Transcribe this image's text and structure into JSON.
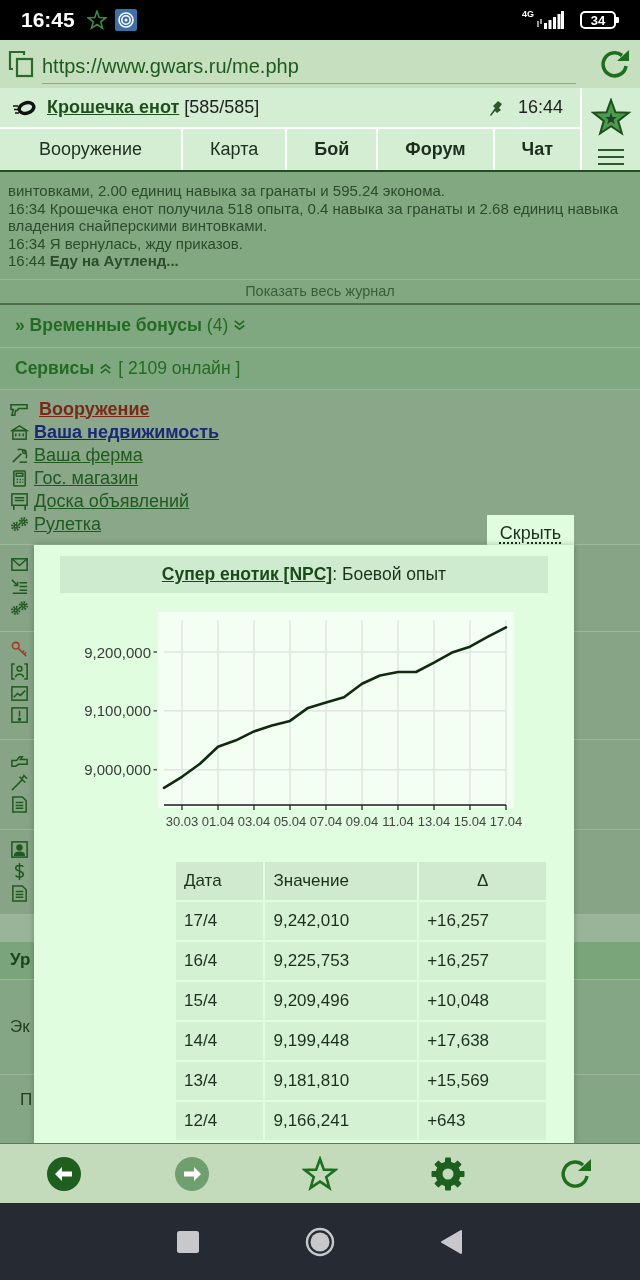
{
  "status_bar": {
    "time": "16:45",
    "network": "4G",
    "battery": "34"
  },
  "browser": {
    "url": "https://www.gwars.ru/me.php"
  },
  "header": {
    "player_name": "Крошечка енот",
    "hp": "[585/585]",
    "time": "16:44"
  },
  "nav_tabs": [
    {
      "label": "Вооружение",
      "emphasized": false
    },
    {
      "label": "Карта",
      "emphasized": false
    },
    {
      "label": "Бой",
      "emphasized": true
    },
    {
      "label": "Форум",
      "emphasized": true
    },
    {
      "label": "Чат",
      "emphasized": true
    }
  ],
  "log": {
    "entries": [
      "винтовками, 2.00 единиц навыка за гранаты и 595.24 эконома.",
      "16:34 Крошечка енот получила 518 опыта, 0.4 навыка за гранаты и 2.68 единиц навыка владения снайперскими винтовками.",
      "16:34 Я вернулась, жду приказов.",
      "16:44 **Еду на Аутленд...**"
    ],
    "show_all": "Показать весь журнал"
  },
  "bonuses": {
    "label": "» Временные бонусы",
    "count": "(4)",
    "expanded": false
  },
  "services": {
    "label": "Сервисы",
    "online": "[ 2109 онлайн ]",
    "expanded": true,
    "items": [
      {
        "label": "Вооружение",
        "kind": "current"
      },
      {
        "label": "Ваша недвижимость",
        "kind": "notice"
      },
      {
        "label": "Ваша ферма",
        "kind": "link"
      },
      {
        "label": "Гос. магазин",
        "kind": "link"
      },
      {
        "label": "Доска объявлений",
        "kind": "link"
      },
      {
        "label": "Рулетка",
        "kind": "link"
      }
    ]
  },
  "section": {
    "heading": "Ур",
    "rows": [
      "Эк",
      "П"
    ]
  },
  "popup": {
    "hide_button": "Скрыть",
    "title_link": "Супер енотик [NPC]",
    "title_text": ": Боевой опыт",
    "chart_data": {
      "type": "line",
      "grid": true,
      "categories": [
        null,
        "30.03",
        null,
        "01.04",
        null,
        "03.04",
        null,
        "05.04",
        null,
        "07.04",
        null,
        "09.04",
        null,
        "11.04",
        null,
        "13.04",
        null,
        "15.04",
        null,
        "17.04"
      ],
      "series": [
        {
          "color": "#0f2a0f",
          "values": [
            8969000,
            8988000,
            9010000,
            9039000,
            9050000,
            9065000,
            9075000,
            9083000,
            9105000,
            9114000,
            9123000,
            9146000,
            9160000,
            9166000,
            9166000,
            9182000,
            9199000,
            9209000,
            9226000,
            9242000
          ]
        }
      ],
      "ylim": [
        8940000,
        9268000
      ],
      "yticks": [
        {
          "value": 9000000,
          "label": "9,000,000"
        },
        {
          "value": 9100000,
          "label": "9,100,000"
        },
        {
          "value": 9200000,
          "label": "9,200,000"
        }
      ]
    },
    "table": {
      "columns": [
        "Дата",
        "Значение",
        "Δ"
      ],
      "rows": [
        [
          "17/4",
          "9,242,010",
          "+16,257"
        ],
        [
          "16/4",
          "9,225,753",
          "+16,257"
        ],
        [
          "15/4",
          "9,209,496",
          "+10,048"
        ],
        [
          "14/4",
          "9,199,448",
          "+17,638"
        ],
        [
          "13/4",
          "9,181,810",
          "+15,569"
        ],
        [
          "12/4",
          "9,166,241",
          "+643"
        ]
      ]
    }
  },
  "toolbar": {
    "back": {
      "disabled": false
    },
    "forward": {
      "disabled": true
    }
  }
}
